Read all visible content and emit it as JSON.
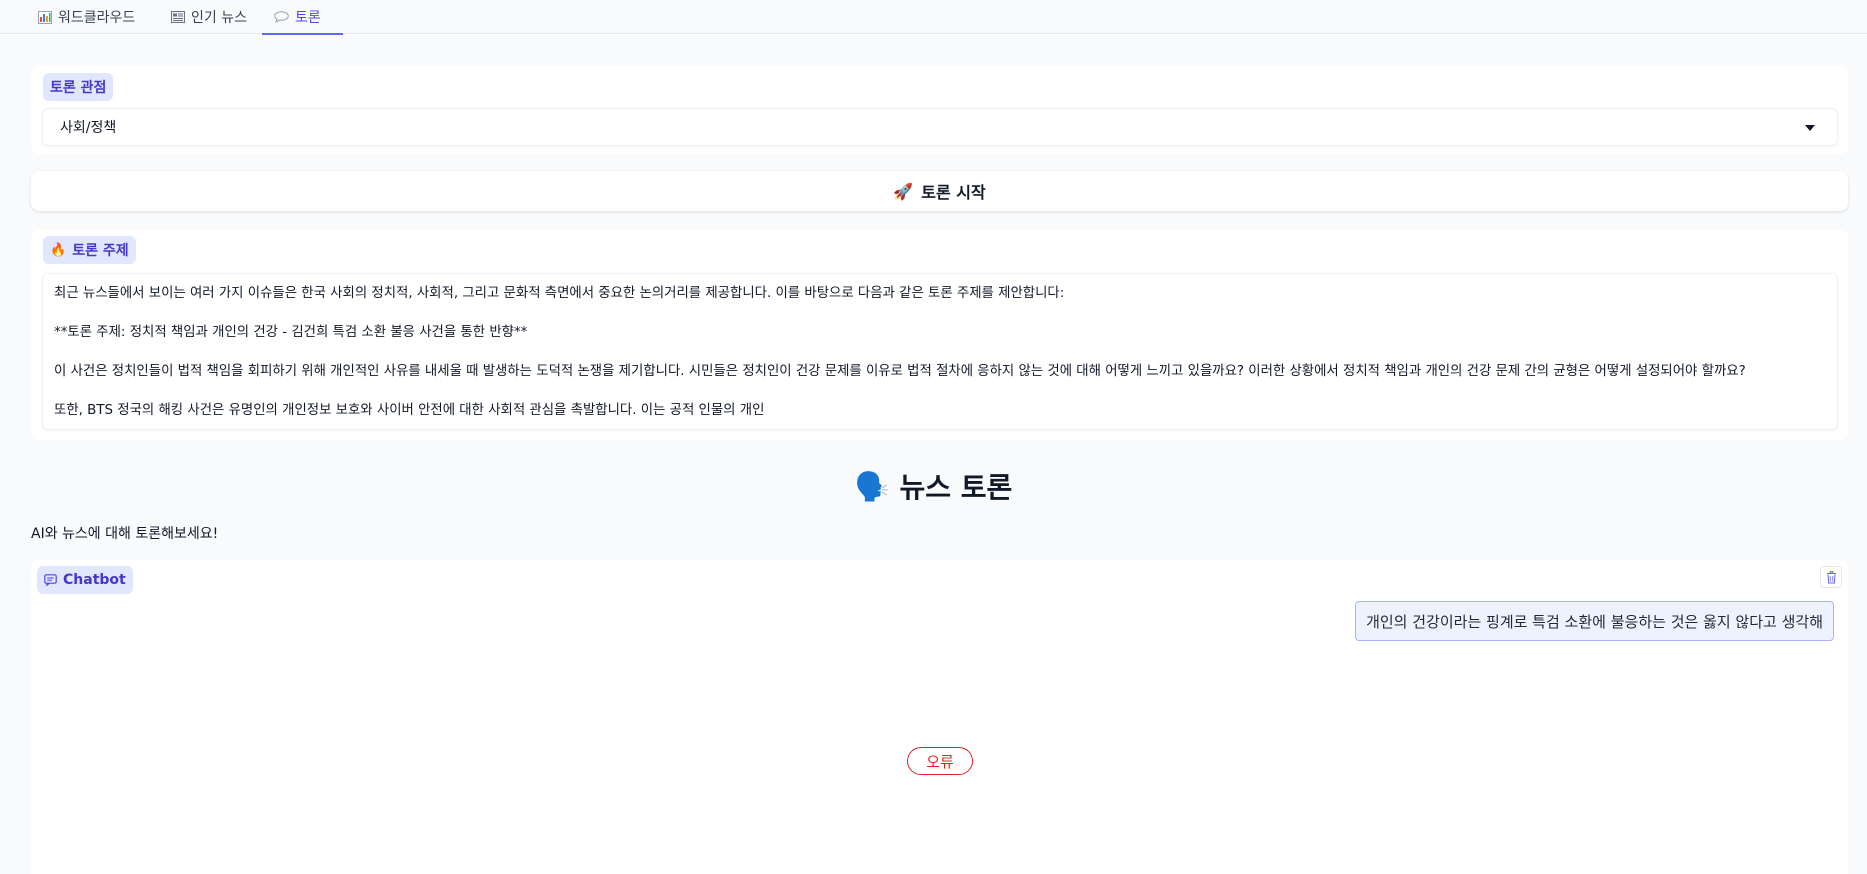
{
  "tabs": [
    {
      "label": "워드클라우드",
      "icon": "bar-chart-icon"
    },
    {
      "label": "인기 뉴스",
      "icon": "newspaper-icon"
    },
    {
      "label": "토론",
      "icon": "speech-bubble-icon",
      "active": true
    }
  ],
  "perspective": {
    "label": "토론 관점",
    "selected": "사회/정책"
  },
  "start_button": {
    "emoji": "🚀",
    "label": "토론 시작"
  },
  "topic": {
    "emoji": "🔥",
    "label": "토론 주제",
    "paragraphs": [
      "최근 뉴스들에서 보이는 여러 가지 이슈들은 한국 사회의 정치적, 사회적, 그리고 문화적 측면에서 중요한 논의거리를 제공합니다. 이를 바탕으로 다음과 같은 토론 주제를 제안합니다:",
      "**토론 주제: 정치적 책임과 개인의 건강 - 김건희 특검 소환 불응 사건을 통한 반향**",
      "이 사건은 정치인들이 법적 책임을 회피하기 위해 개인적인 사유를 내세울 때 발생하는 도덕적 논쟁을 제기합니다. 시민들은 정치인이 건강 문제를 이유로 법적 절차에 응하지 않는 것에 대해 어떻게 느끼고 있을까요? 이러한 상황에서 정치적 책임과 개인의 건강 문제 간의 균형은 어떻게 설정되어야 할까요?",
      "또한, BTS 정국의 해킹 사건은 유명인의 개인정보 보호와 사이버 안전에 대한 사회적 관심을 촉발합니다. 이는 공적 인물의 개인"
    ]
  },
  "discussion": {
    "emoji": "🗣️",
    "title": "뉴스 토론",
    "subtitle": "AI와 뉴스에 대해 토론해보세요!"
  },
  "chatbot": {
    "label": "Chatbot",
    "user_message": "개인의 건강이라는 핑계로 특검 소환에 불응하는 것은 옳지 않다고 생각해",
    "error_label": "오류"
  },
  "colors": {
    "accent": "#4f46e5",
    "chip_bg": "#e0e7ff",
    "error": "#dc2626",
    "page_bg": "#f8fafc"
  }
}
